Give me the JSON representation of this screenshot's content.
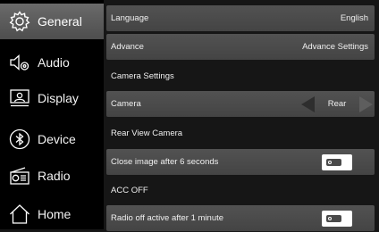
{
  "sidebar": {
    "items": [
      {
        "label": "General",
        "icon": "gear-icon"
      },
      {
        "label": "Audio",
        "icon": "speaker-icon"
      },
      {
        "label": "Display",
        "icon": "display-icon"
      },
      {
        "label": "Device",
        "icon": "bluetooth-icon"
      },
      {
        "label": "Radio",
        "icon": "radio-icon"
      },
      {
        "label": "Home",
        "icon": "home-icon"
      }
    ]
  },
  "settings": {
    "language": {
      "label": "Language",
      "value": "English"
    },
    "advance": {
      "label": "Advance",
      "value": "Advance Settings"
    },
    "camera_section": "Camera Settings",
    "camera": {
      "label": "Camera",
      "value": "Rear"
    },
    "rear_view_section": "Rear View Camera",
    "close_image": {
      "label": "Close image after 6 seconds",
      "on": true
    },
    "acc_section": "ACC OFF",
    "radio_off": {
      "label": "Radio off active after 1 minute",
      "on": true
    }
  },
  "colors": {
    "active_nav": "#5c5c5c",
    "row_bg": "#4b4b4b",
    "background": "#161616",
    "sidebar_bg": "#000000"
  }
}
